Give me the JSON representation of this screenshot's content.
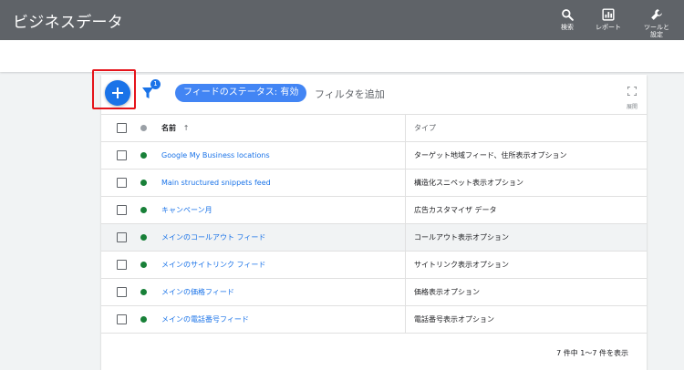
{
  "app": {
    "title": "ビジネスデータ"
  },
  "toolbar_actions": [
    {
      "icon": "search-icon",
      "label": "検索"
    },
    {
      "icon": "report-icon",
      "label": "レポート"
    },
    {
      "icon": "wrench-icon",
      "label": "ツールと\n設定"
    }
  ],
  "filters": {
    "badge_count": "1",
    "status_chip": "フィードのステータス: 有効",
    "add_filter": "フィルタを追加",
    "expand_label": "展開"
  },
  "table": {
    "columns": {
      "name": "名前",
      "type": "タイプ"
    },
    "sort_indicator": "↑",
    "rows": [
      {
        "name": "Google My Business locations",
        "type": "ターゲット地域フィード、住所表示オプション",
        "status": "active"
      },
      {
        "name": "Main structured snippets feed",
        "type": "構造化スニペット表示オプション",
        "status": "active"
      },
      {
        "name": "キャンペーン月",
        "type": "広告カスタマイザ データ",
        "status": "active"
      },
      {
        "name": "メインのコールアウト フィード",
        "type": "コールアウト表示オプション",
        "status": "active"
      },
      {
        "name": "メインのサイトリンク フィード",
        "type": "サイトリンク表示オプション",
        "status": "active"
      },
      {
        "name": "メインの価格フィード",
        "type": "価格表示オプション",
        "status": "active"
      },
      {
        "name": "メインの電話番号フィード",
        "type": "電話番号表示オプション",
        "status": "active"
      }
    ],
    "footer": "7 件中 1～7 件を表示"
  },
  "colors": {
    "header_bg": "#5f6368",
    "accent": "#1a73e8",
    "chip": "#4285f4",
    "status_active": "#188038",
    "status_header": "#9aa0a6",
    "highlight_box": "#e5141b"
  }
}
